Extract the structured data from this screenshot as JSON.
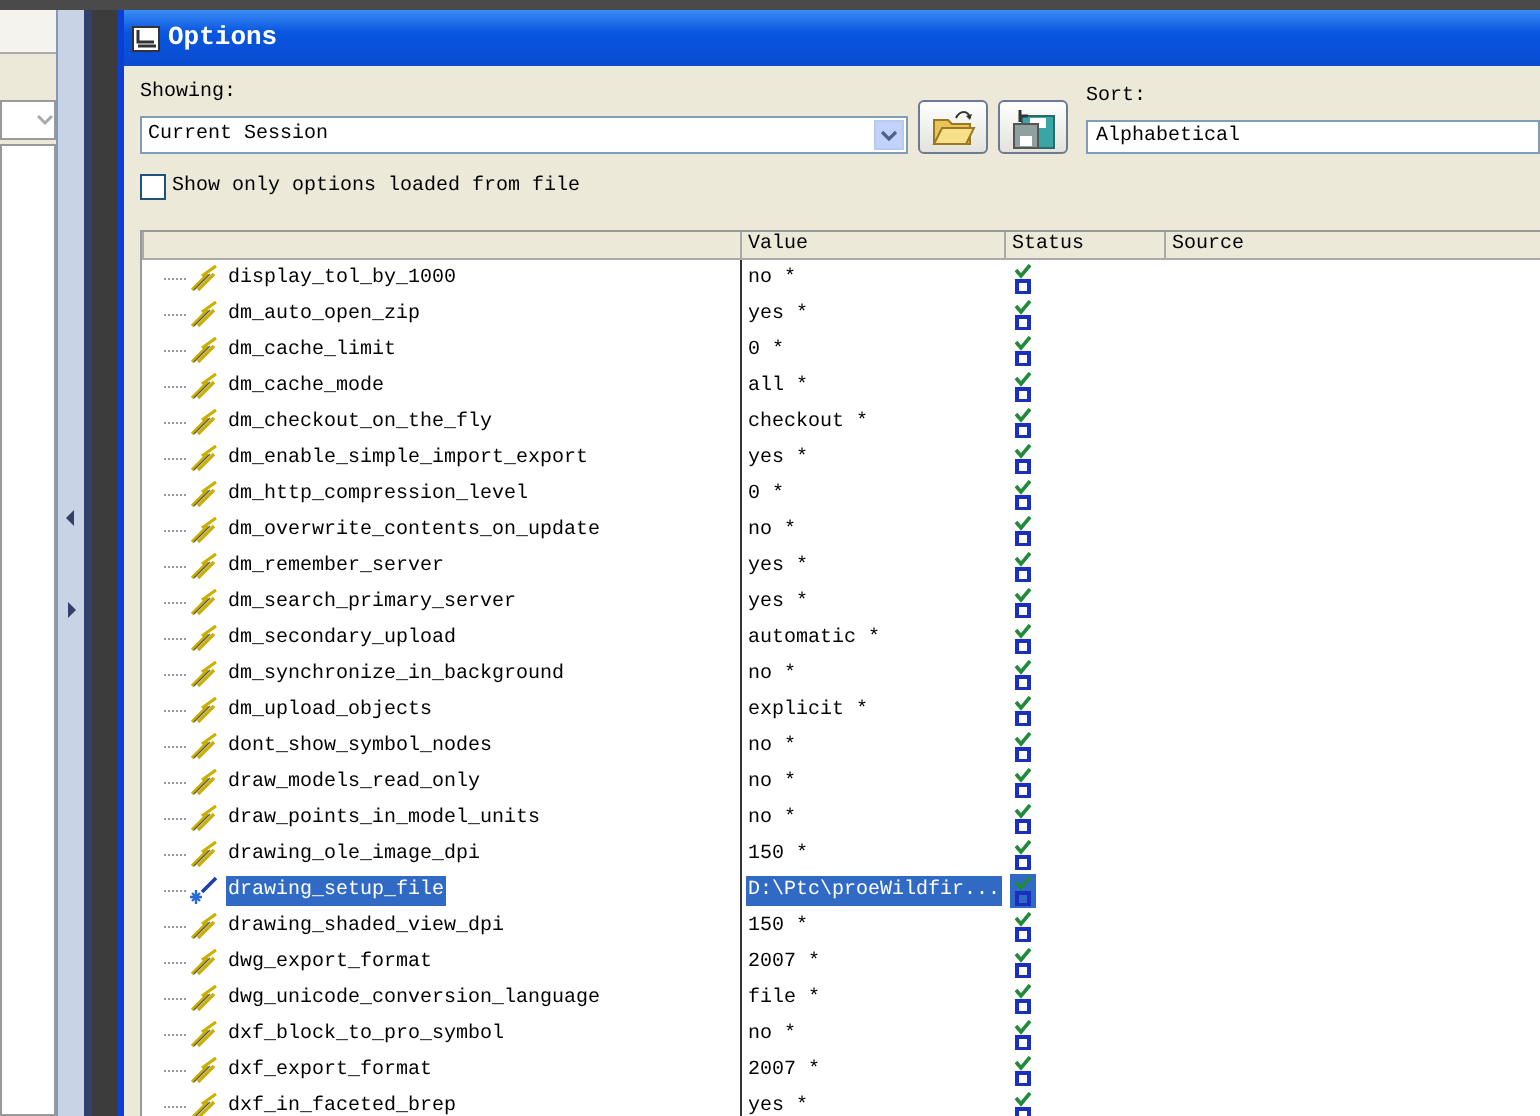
{
  "window": {
    "title": "Options"
  },
  "showing": {
    "label": "Showing:",
    "value": "Current Session"
  },
  "sort": {
    "label": "Sort:",
    "value": "Alphabetical"
  },
  "show_only_loaded": {
    "label": "Show only options loaded from file",
    "checked": false
  },
  "table": {
    "columns": [
      "Value",
      "Status",
      "Source"
    ],
    "rows": [
      {
        "name": "display_tol_by_1000",
        "value": "no *",
        "kind": "default",
        "selected": false
      },
      {
        "name": "dm_auto_open_zip",
        "value": "yes *",
        "kind": "default",
        "selected": false
      },
      {
        "name": "dm_cache_limit",
        "value": "0 *",
        "kind": "default",
        "selected": false
      },
      {
        "name": "dm_cache_mode",
        "value": "all *",
        "kind": "default",
        "selected": false
      },
      {
        "name": "dm_checkout_on_the_fly",
        "value": "checkout *",
        "kind": "default",
        "selected": false
      },
      {
        "name": "dm_enable_simple_import_export",
        "value": "yes *",
        "kind": "default",
        "selected": false
      },
      {
        "name": "dm_http_compression_level",
        "value": "0 *",
        "kind": "default",
        "selected": false
      },
      {
        "name": "dm_overwrite_contents_on_update",
        "value": "no *",
        "kind": "default",
        "selected": false
      },
      {
        "name": "dm_remember_server",
        "value": "yes *",
        "kind": "default",
        "selected": false
      },
      {
        "name": "dm_search_primary_server",
        "value": "yes *",
        "kind": "default",
        "selected": false
      },
      {
        "name": "dm_secondary_upload",
        "value": "automatic *",
        "kind": "default",
        "selected": false
      },
      {
        "name": "dm_synchronize_in_background",
        "value": "no *",
        "kind": "default",
        "selected": false
      },
      {
        "name": "dm_upload_objects",
        "value": "explicit *",
        "kind": "default",
        "selected": false
      },
      {
        "name": "dont_show_symbol_nodes",
        "value": "no *",
        "kind": "default",
        "selected": false
      },
      {
        "name": "draw_models_read_only",
        "value": "no *",
        "kind": "default",
        "selected": false
      },
      {
        "name": "draw_points_in_model_units",
        "value": "no *",
        "kind": "default",
        "selected": false
      },
      {
        "name": "drawing_ole_image_dpi",
        "value": "150 *",
        "kind": "default",
        "selected": false
      },
      {
        "name": "drawing_setup_file",
        "value": "D:\\Ptc\\proeWildfir...",
        "kind": "modified",
        "selected": true
      },
      {
        "name": "drawing_shaded_view_dpi",
        "value": "150 *",
        "kind": "default",
        "selected": false
      },
      {
        "name": "dwg_export_format",
        "value": "2007 *",
        "kind": "default",
        "selected": false
      },
      {
        "name": "dwg_unicode_conversion_language",
        "value": "file *",
        "kind": "default",
        "selected": false
      },
      {
        "name": "dxf_block_to_pro_symbol",
        "value": "no *",
        "kind": "default",
        "selected": false
      },
      {
        "name": "dxf_export_format",
        "value": "2007 *",
        "kind": "default",
        "selected": false
      },
      {
        "name": "dxf_in_faceted_brep",
        "value": "yes *",
        "kind": "default",
        "selected": false
      }
    ]
  }
}
